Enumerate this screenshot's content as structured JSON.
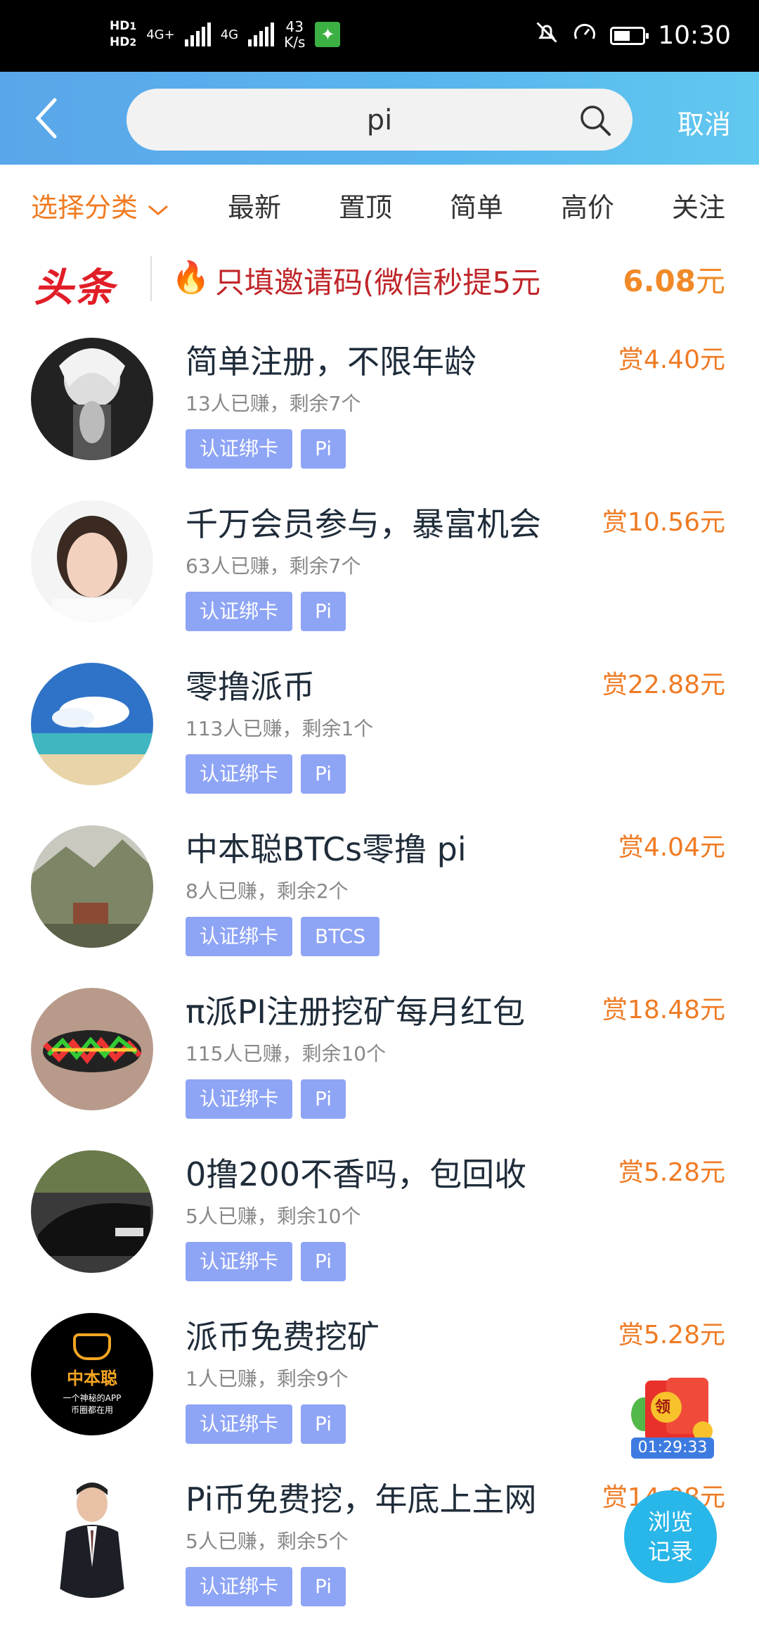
{
  "status_bar": {
    "hd1": "HD",
    "hd1_sub": "1",
    "hd2": "HD",
    "hd2_sub": "2",
    "net1": "4G+",
    "net2": "4G",
    "speed_value": "43",
    "speed_unit": "K/s",
    "time": "10:30"
  },
  "search": {
    "query": "pi",
    "cancel_label": "取消"
  },
  "tabs": [
    {
      "label": "选择分类",
      "active": true
    },
    {
      "label": "最新"
    },
    {
      "label": "置顶"
    },
    {
      "label": "简单"
    },
    {
      "label": "高价"
    },
    {
      "label": "关注"
    }
  ],
  "headline": {
    "logo": "头条",
    "text": "只填邀请码(微信秒提5元",
    "amount": "6.08",
    "amount_unit": "元"
  },
  "tasks": [
    {
      "title": "简单注册，不限年龄",
      "meta": "13人已赚，剩余7个",
      "tags": [
        "认证绑卡",
        "Pi"
      ],
      "reward": "赏4.40元"
    },
    {
      "title": "千万会员参与，暴富机会",
      "meta": "63人已赚，剩余7个",
      "tags": [
        "认证绑卡",
        "Pi"
      ],
      "reward": "赏10.56元"
    },
    {
      "title": "零撸派币",
      "meta": "113人已赚，剩余1个",
      "tags": [
        "认证绑卡",
        "Pi"
      ],
      "reward": "赏22.88元"
    },
    {
      "title": "中本聪BTCs零撸 pi",
      "meta": "8人已赚，剩余2个",
      "tags": [
        "认证绑卡",
        "BTCS"
      ],
      "reward": "赏4.04元"
    },
    {
      "title": "π派PI注册挖矿每月红包",
      "meta": "115人已赚，剩余10个",
      "tags": [
        "认证绑卡",
        "Pi"
      ],
      "reward": "赏18.48元"
    },
    {
      "title": "0撸200不香吗，包回收",
      "meta": "5人已赚，剩余10个",
      "tags": [
        "认证绑卡",
        "Pi"
      ],
      "reward": "赏5.28元"
    },
    {
      "title": "派币免费挖矿",
      "meta": "1人已赚，剩余9个",
      "tags": [
        "认证绑卡",
        "Pi"
      ],
      "reward": "赏5.28元"
    },
    {
      "title": "Pi币免费挖，年底上主网",
      "meta": "5人已赚，剩余5个",
      "tags": [
        "认证绑卡",
        "Pi"
      ],
      "reward": "赏14.08元"
    }
  ],
  "avatar7": {
    "line1": "中本聪",
    "line2": "一个神秘的APP",
    "line3": "币圈都在用"
  },
  "float": {
    "redpacket_label": "领",
    "timer": "01:29:33",
    "browse_line1": "浏览",
    "browse_line2": "记录"
  },
  "colors": {
    "accent_orange": "#ef7b24",
    "tag_bg": "#8ea4f5",
    "header_blue": "#5aa6ea",
    "headline_red": "#e11e27"
  }
}
